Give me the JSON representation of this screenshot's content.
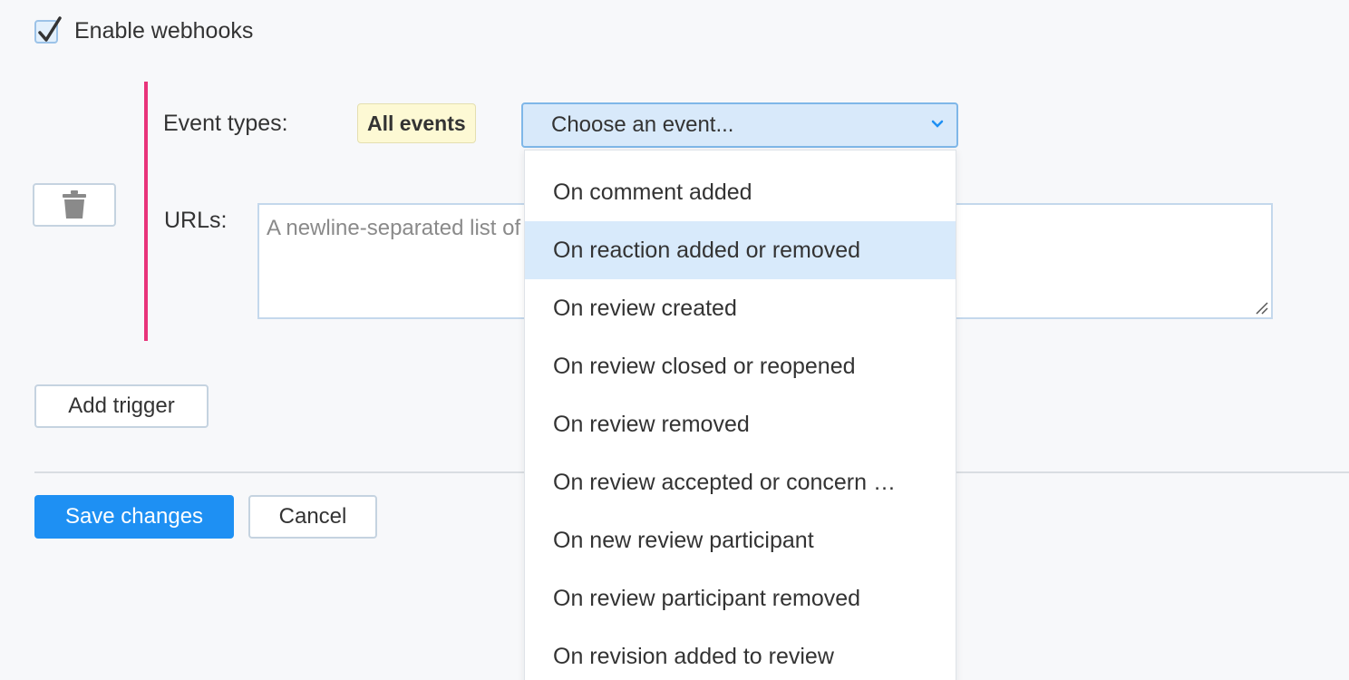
{
  "webhooks": {
    "enable_label": "Enable webhooks",
    "enabled": true
  },
  "trigger": {
    "event_types_label": "Event types:",
    "all_events_badge": "All events",
    "event_select_value": "Choose an event...",
    "urls_label": "URLs:",
    "urls_placeholder": "A newline-separated list of URLs"
  },
  "dropdown": {
    "options": [
      "On comment added",
      "On reaction added or removed",
      "On review created",
      "On review closed or reopened",
      "On review removed",
      "On review accepted or concern …",
      "On new review participant",
      "On review participant removed",
      "On revision added to review"
    ],
    "highlighted_index": 1
  },
  "actions": {
    "add_trigger": "Add trigger",
    "save": "Save changes",
    "cancel": "Cancel"
  },
  "colors": {
    "accent": "#1e90f3",
    "trigger_bar": "#e8347a",
    "badge_bg": "#fdf9d4",
    "highlight": "#d8eafb"
  },
  "icons": {
    "delete": "trash-icon",
    "select": "chevron-down-icon",
    "checkbox": "checkmark-icon"
  }
}
